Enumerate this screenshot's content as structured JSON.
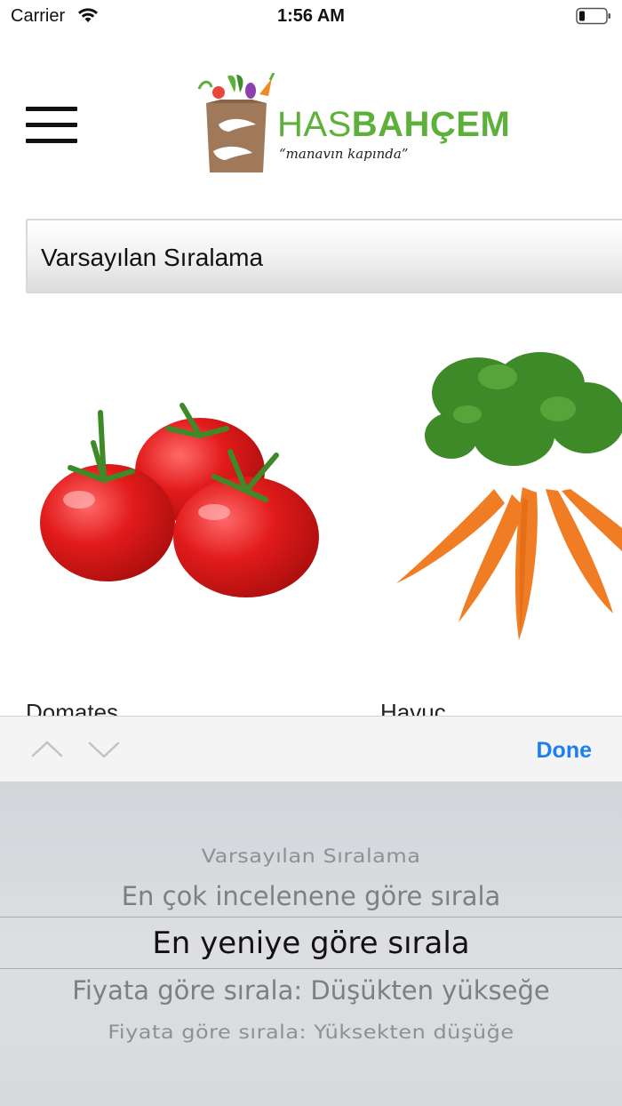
{
  "status_bar": {
    "carrier": "Carrier",
    "time": "1:56 AM"
  },
  "header": {
    "logo": {
      "brand_part1": "HAS",
      "brand_part2": "BAHÇEM",
      "tagline": "“manavın kapında”"
    }
  },
  "sort": {
    "selected": "Varsayılan Sıralama"
  },
  "products": [
    {
      "name": "Domates",
      "image": "tomatoes"
    },
    {
      "name": "Havuç",
      "image": "carrots"
    }
  ],
  "toolbar": {
    "done_label": "Done"
  },
  "picker": {
    "options": [
      "Varsayılan Sıralama",
      "En çok incelenene göre sırala",
      "En yeniye göre sırala",
      "Fiyata göre sırala: Düşükten yükseğe",
      "Fiyata göre sırala: Yüksekten düşüğe"
    ],
    "selected": "En yeniye göre sırala"
  },
  "colors": {
    "brand_green": "#5db13a",
    "brand_brown": "#a0785a",
    "done_blue": "#1a7ff5"
  }
}
